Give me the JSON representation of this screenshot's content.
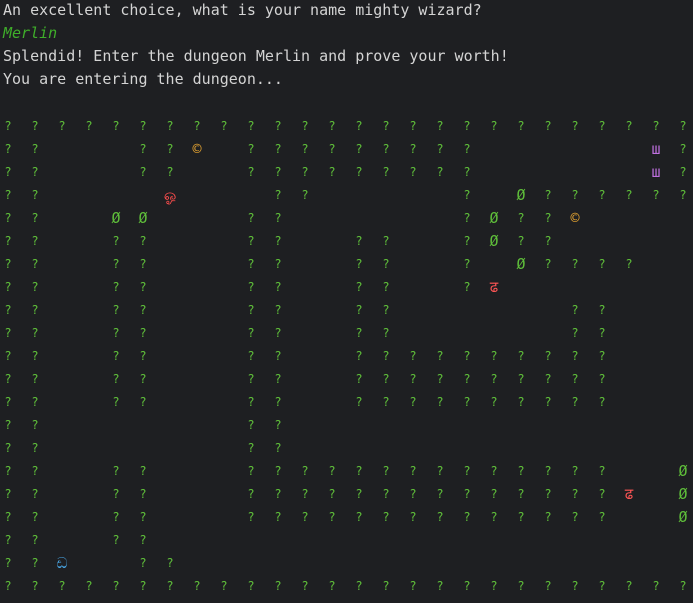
{
  "terminal": {
    "lines": [
      {
        "text": "An excellent choice, what is your name mighty wizard?",
        "color": "#d4d4d4",
        "style": "normal"
      },
      {
        "text": "Merlin",
        "color": "#3fae2a",
        "style": "name"
      },
      {
        "text": "Splendid! Enter the dungeon Merlin and prove your worth!",
        "color": "#d4d4d4",
        "style": "normal"
      },
      {
        "text": "You are entering the dungeon...",
        "color": "#d4d4d4",
        "style": "normal"
      }
    ]
  },
  "colors": {
    "wall": "#5fbf3a",
    "treasure": "#e0a030",
    "player": "#ff4d4d",
    "monster": "#c070e0",
    "enemy": "#ff5555",
    "door": "#4aa8e8"
  },
  "legend": {
    "wall": "?",
    "treasure": "©",
    "ghost_ou": "ஓ",
    "player_a": "ढ़",
    "monster_sha": "ш",
    "enemy": "ढ",
    "door": "ඩ",
    "alt_wall": "Ø"
  },
  "dungeon": {
    "rows": [
      "? ? ? ? ? ? ? ? ? ? ? ? ? ? ? ? ? ? ? ? ? ? ? ? ? ?",
      "? ?       ? ? ©   ? ? ? ? ? ? ? ? ?             ш ?",
      "? ?       ? ?     ? ? ? ? ? ? ? ? ?             ш ?",
      "? ?         ஓ       ? ?           ?   Ø ? ? ? ? ? ? ?",
      "? ?     Ø Ø       ? ?             ? Ø ? ? ©         ",
      "? ?     ? ?       ? ?     ? ?     ? Ø ? ?           ",
      "? ?     ? ?       ? ?     ? ?     ?   Ø ? ? ? ?     ",
      "? ?     ? ?       ? ?     ? ?     ? ढ़ Ø ? ? ? ?     ?",
      "? ?     ? ?       ? ?     ? ?             ? ?       ",
      "? ?     ? ?       ? ?     ? ?             ? ?       ",
      "? ?     ? ?       ? ?     ? ? ? ? ? ? ? ? ? ?       ",
      "? ?     ? ?       ? ?     ? ? ? ? ? ? ? ? ? ?       ",
      "? ?     ? ?       ? ?     ? ? ? ? ? ? ? ? ? ?       ",
      "? ?               ? ?                               ",
      "? ?               ? ?                               ",
      "? ?     ? ?       ? ? ? ? ? ? ? ? ? ? ? ? ? ?     Ø ?",
      "? ?     ? ?       ? ? ? ? ? ? ? ? ? ? ? ? ? ? ढ   Ø ?",
      "? ?     ? ?       ? ? ? ? ? ? ? ? ? ? ? ? ? ?     Ø ?",
      "? ?     ? ?                                         ?",
      "? ? ඩ     ? ?                                       ?",
      "? ? ? ? ? ? ? ? ? ? ? ? ? ? ? ? ? ? ? ? ? ? ? ? ? ?"
    ]
  }
}
